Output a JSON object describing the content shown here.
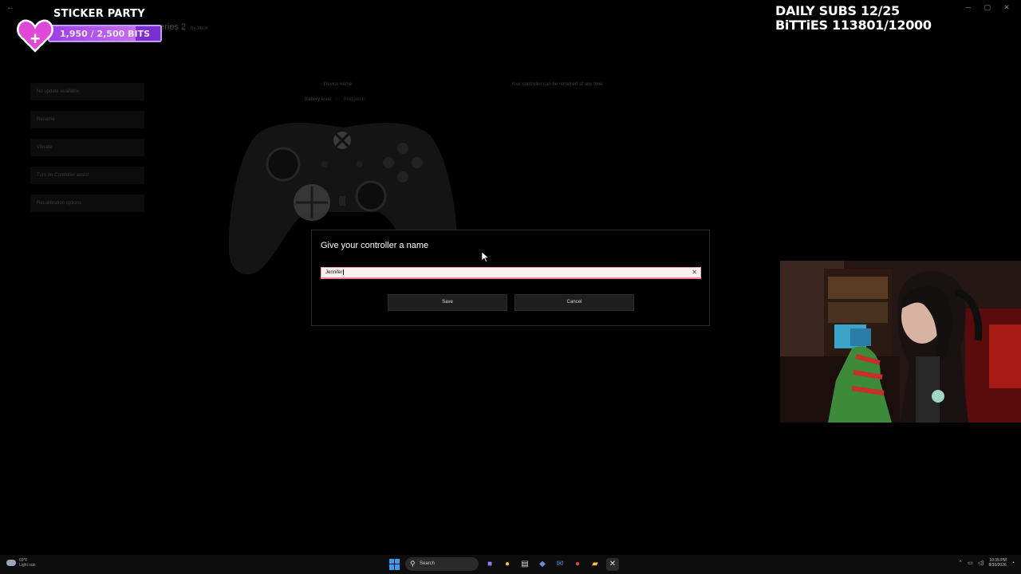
{
  "window": {
    "back_glyph": "←",
    "controls": [
      "─",
      "▢",
      "✕"
    ]
  },
  "overlay": {
    "sticker_title": "STICKER PARTY",
    "bits_progress": "1,950 / 2,500 BITS",
    "bits_fraction": 0.78,
    "daily_subs": "DAILY SUBS 12/25",
    "bitties": "BiTTiES 113801/12000"
  },
  "app": {
    "title_fragment": "eries 2",
    "title_by": "by Xbox",
    "device_name_label": "Device name:",
    "battery_label": "Battery level:",
    "battery_value": "Plugged in",
    "rename_hint": "Your controller can be renamed at any time."
  },
  "sidebar": {
    "items": [
      {
        "label": "No update available"
      },
      {
        "label": "Rename"
      },
      {
        "label": "Vibrate"
      },
      {
        "label": "Turn on Controller assist"
      },
      {
        "label": "Recalibration options"
      }
    ]
  },
  "dialog": {
    "title": "Give your controller a name",
    "input_value": "Jennifer",
    "clear_glyph": "✕",
    "save_label": "Save",
    "cancel_label": "Cancel"
  },
  "taskbar": {
    "weather_temp": "69°F",
    "weather_desc": "Light rain",
    "search_label": "Search",
    "time": "10:35 PM",
    "date": "8/30/2026",
    "colors": {
      "start": "#3c9bf0"
    }
  }
}
